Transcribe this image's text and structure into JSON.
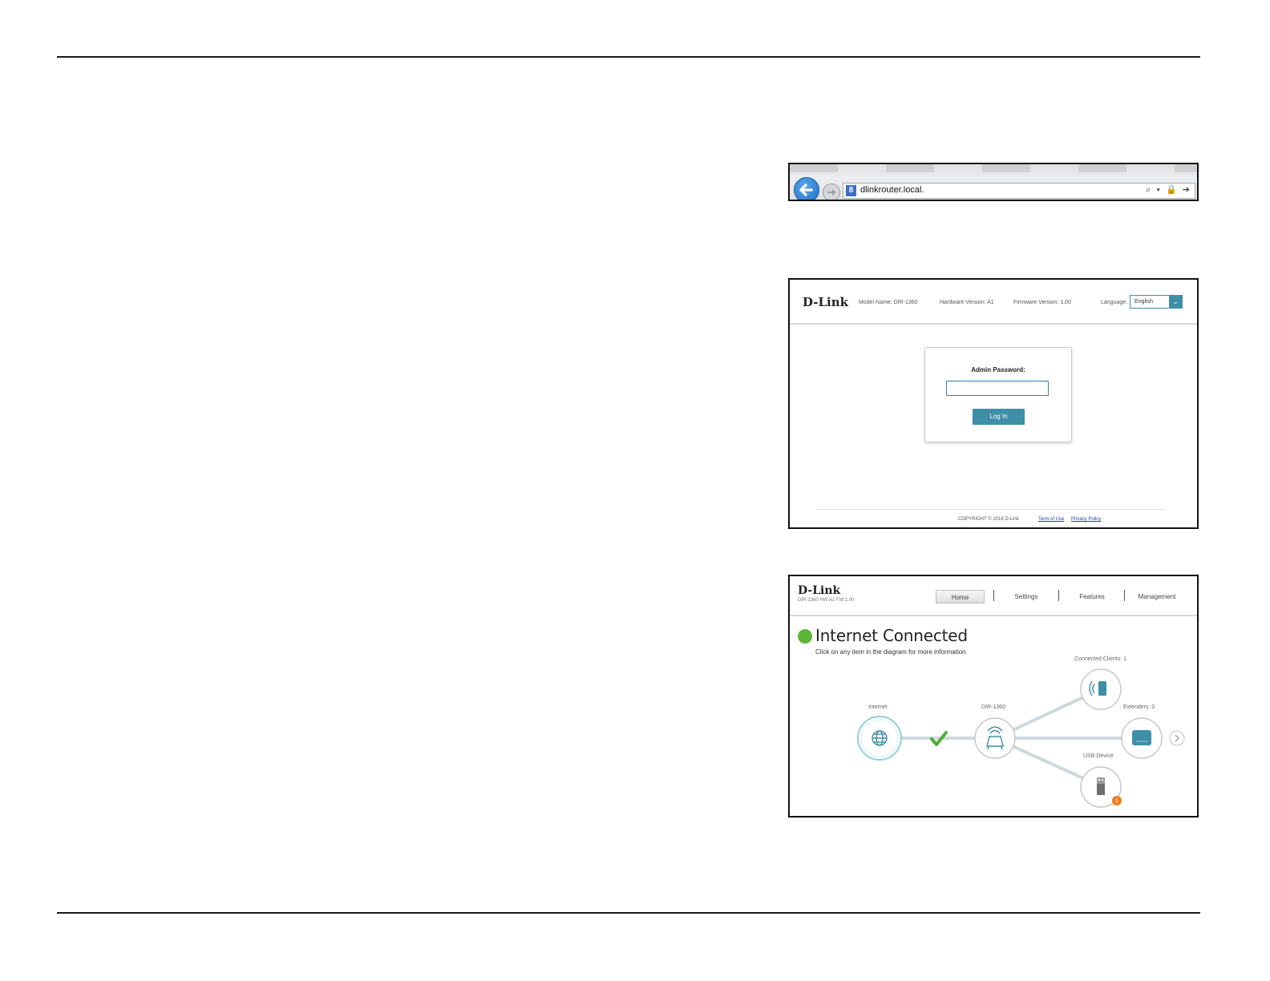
{
  "browser": {
    "url": "dlinkrouter.local.",
    "favicon": "8",
    "icons": "⌕ ▾ 🔒 ➔"
  },
  "login": {
    "logo": "D-Link",
    "model_name": "Model Name: DIR-1360",
    "hardware_version": "Hardware Version: A1",
    "firmware_version": "Firmware Version: 1.00",
    "language_label": "Language:",
    "language_value": "English",
    "password_label": "Admin Password:",
    "password_value": "",
    "login_button": "Log In",
    "copyright": "COPYRIGHT © 2016 D-Link",
    "terms_link": "Term of Use",
    "privacy_link": "Privacy Policy"
  },
  "home": {
    "logo": "D-Link",
    "subtitle": "DIR-1360 HW:A1 FW:1.00",
    "tabs": [
      "Home",
      "Settings",
      "Features",
      "Management"
    ],
    "status_title": "Internet Connected",
    "hint": "Click on any item in the diagram for more information.",
    "nodes": {
      "internet": "Internet",
      "router": "DIR-1360",
      "clients": "Connected Clients: 1",
      "extenders": "Extenders: 0",
      "usb": "USB Device"
    }
  },
  "colors": {
    "accent_teal": "#3d8fa6",
    "status_green": "#5db63a",
    "warning_orange": "#f07c1c",
    "link_blue": "#2a3fa0"
  }
}
